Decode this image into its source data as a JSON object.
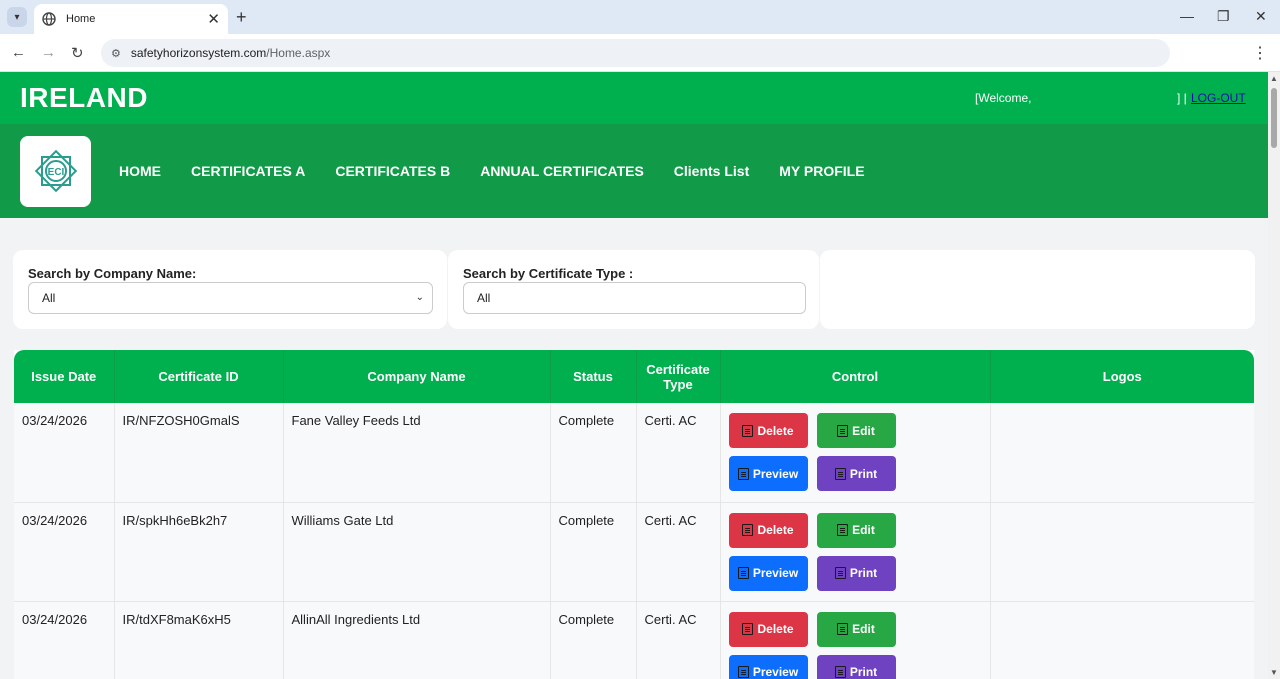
{
  "browser": {
    "tab_title": "Home",
    "url_host": "safetyhorizonsystem.com",
    "url_path": "/Home.aspx"
  },
  "header": {
    "brand": "IRELAND",
    "welcome": "[Welcome,",
    "separator": "] |",
    "logout": "LOG-OUT"
  },
  "nav": [
    "HOME",
    "CERTIFICATES A",
    "CERTIFICATES B",
    "ANNUAL CERTIFICATES",
    "Clients List",
    "MY PROFILE"
  ],
  "filters": {
    "company_label": "Search by Company Name:",
    "company_value": "All",
    "type_label": "Search by Certificate Type :",
    "type_value": "All"
  },
  "table": {
    "headers": [
      "Issue Date",
      "Certificate ID",
      "Company Name",
      "Status",
      "Certificate Type",
      "Control",
      "Logos"
    ],
    "rows": [
      {
        "date": "03/24/2026",
        "id": "IR/NFZOSH0GmalS",
        "company": "Fane Valley Feeds Ltd",
        "status": "Complete",
        "type": "Certi. AC"
      },
      {
        "date": "03/24/2026",
        "id": "IR/spkHh6eBk2h7",
        "company": "Williams Gate Ltd",
        "status": "Complete",
        "type": "Certi. AC"
      },
      {
        "date": "03/24/2026",
        "id": "IR/tdXF8maK6xH5",
        "company": "AllinAll Ingredients Ltd",
        "status": "Complete",
        "type": "Certi. AC"
      }
    ],
    "buttons": {
      "delete": "Delete",
      "edit": "Edit",
      "preview": "Preview",
      "print": "Print"
    }
  },
  "colors": {
    "header_green": "#00b04f",
    "nav_green": "#119a47",
    "delete": "#dc3545",
    "edit": "#28a745",
    "preview": "#0d6efd",
    "print": "#6f42c1"
  }
}
